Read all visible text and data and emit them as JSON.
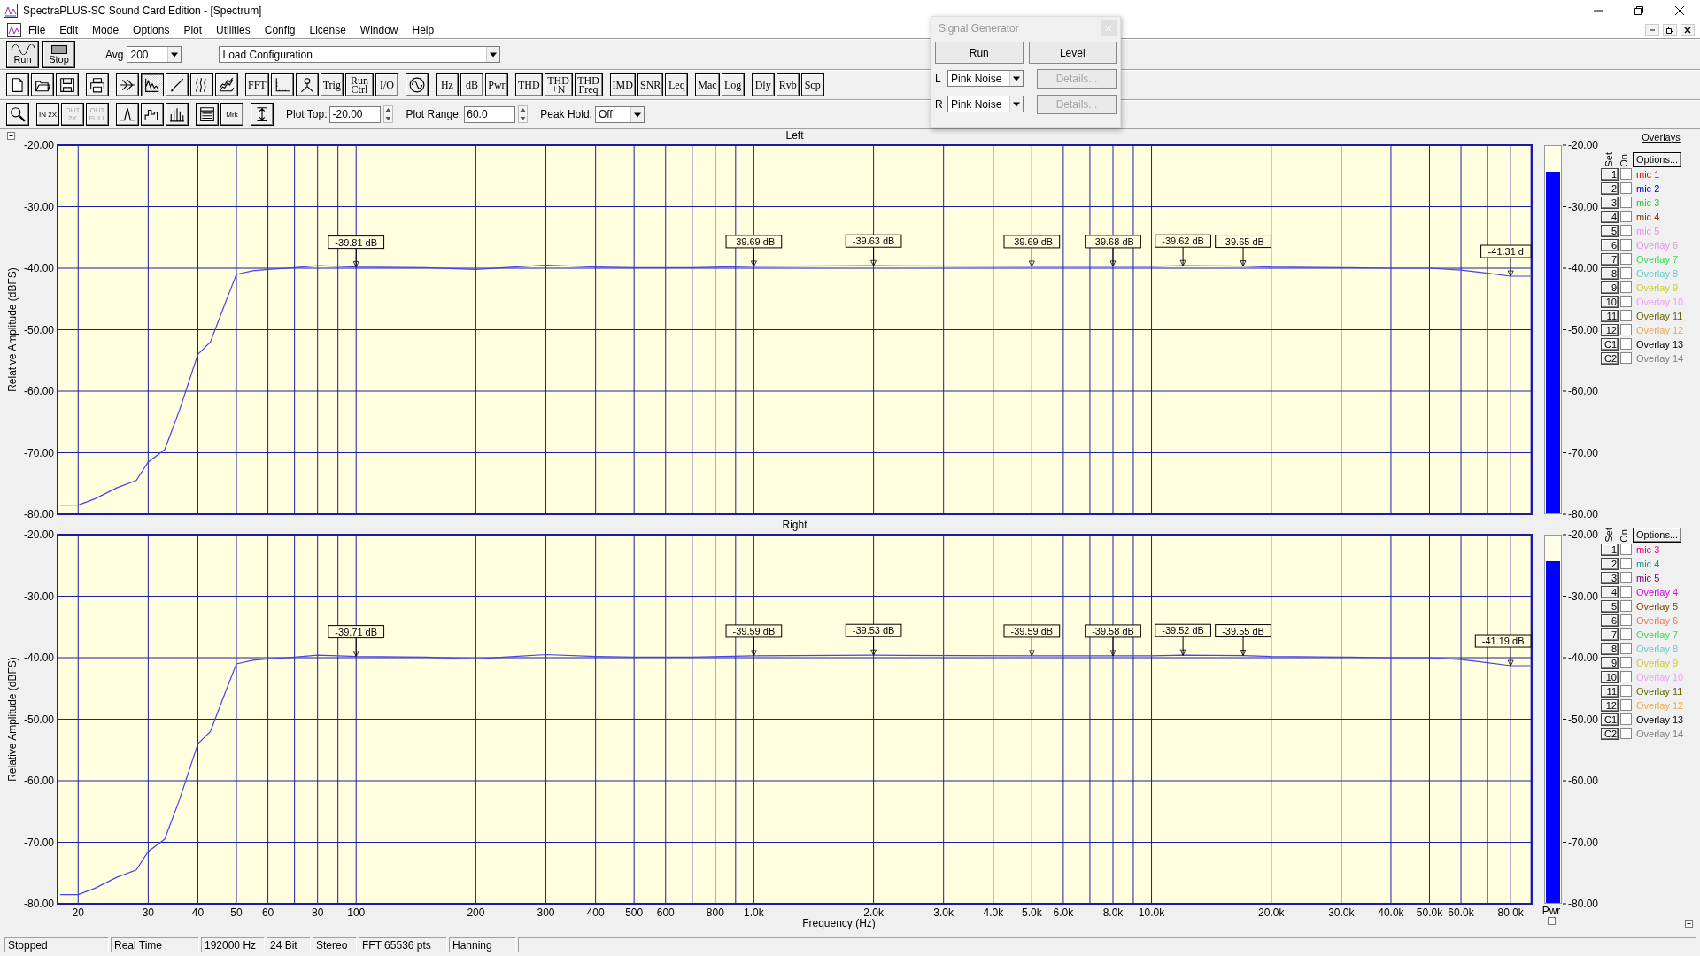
{
  "window": {
    "title": "SpectraPLUS-SC Sound Card Edition - [Spectrum]"
  },
  "menu": [
    "File",
    "Edit",
    "Mode",
    "Options",
    "Plot",
    "Utilities",
    "Config",
    "License",
    "Window",
    "Help"
  ],
  "toolbar1": {
    "run": "Run",
    "stop": "Stop",
    "avg_label": "Avg",
    "avg": "200",
    "config": "Load Configuration"
  },
  "toolbar2": [
    [
      {
        "kind": "icon"
      },
      {
        "kind": "icon"
      },
      {
        "kind": "icon"
      }
    ],
    [
      {
        "kind": "icon"
      }
    ],
    [
      {
        "kind": "icon",
        "selected": false
      },
      {
        "kind": "icon",
        "selected": true
      },
      {
        "kind": "icon",
        "selected": false
      },
      {
        "kind": "icon",
        "selected": false
      },
      {
        "kind": "icon",
        "selected": false
      }
    ],
    [
      {
        "kind": "text",
        "label": "FFT"
      },
      {
        "kind": "icon"
      },
      {
        "kind": "icon"
      },
      {
        "kind": "text",
        "label": "Trig"
      },
      {
        "kind": "text",
        "label": "Run Ctrl"
      },
      {
        "kind": "text",
        "label": "I/O"
      }
    ],
    [
      {
        "kind": "icon"
      }
    ],
    [
      {
        "kind": "text",
        "label": "Hz"
      },
      {
        "kind": "text",
        "label": "dB"
      },
      {
        "kind": "text",
        "label": "Pwr"
      }
    ],
    [
      {
        "kind": "text",
        "label": "THD"
      },
      {
        "kind": "text",
        "label": "THD +N"
      },
      {
        "kind": "text",
        "label": "THD Freq"
      }
    ],
    [
      {
        "kind": "text",
        "label": "IMD"
      },
      {
        "kind": "text",
        "label": "SNR"
      },
      {
        "kind": "text",
        "label": "Leq"
      }
    ],
    [
      {
        "kind": "text",
        "label": "Mac"
      },
      {
        "kind": "text",
        "label": "Log"
      }
    ],
    [
      {
        "kind": "text",
        "label": "Dly"
      },
      {
        "kind": "text",
        "label": "Rvb"
      },
      {
        "kind": "text",
        "label": "Scp"
      }
    ]
  ],
  "toolbar3": [
    [
      {
        "kind": "icon"
      }
    ],
    [
      {
        "kind": "text",
        "label": "IN 2X",
        "disabled": false
      },
      {
        "kind": "text",
        "label": "OUT 2X",
        "disabled": true
      },
      {
        "kind": "text",
        "label": "OUT FULL",
        "disabled": true
      }
    ],
    [
      {
        "kind": "icon"
      },
      {
        "kind": "icon"
      },
      {
        "kind": "icon"
      }
    ],
    [
      {
        "kind": "icon"
      },
      {
        "kind": "text",
        "label": "Mrk"
      }
    ],
    [
      {
        "kind": "icon"
      }
    ]
  ],
  "plot_controls": [
    {
      "kind": "spin",
      "label": "Plot Top:",
      "value": "-20.00"
    },
    {
      "kind": "spin",
      "label": "Plot Range:",
      "value": "60.0"
    },
    {
      "kind": "select",
      "label": "Peak Hold:",
      "value": "Off"
    }
  ],
  "signal_generator": {
    "title": "Signal Generator",
    "run": "Run",
    "level": "Level",
    "channels": [
      {
        "label": "L",
        "source": "Pink Noise",
        "details": "Details...",
        "disabled": true
      },
      {
        "label": "R",
        "source": "Pink Noise",
        "details": "Details...",
        "disabled": true
      }
    ]
  },
  "plots": [
    {
      "title": "Left",
      "ylabel": "Relative Amplitude (dBFS)",
      "yticks": [
        "-20.00",
        "-30.00",
        "-40.00",
        "-50.00",
        "-60.00",
        "-70.00",
        "-80.00"
      ],
      "markers": [
        "-39.81 dB",
        "-39.69 dB",
        "-39.63 dB",
        "-39.69 dB",
        "-39.68 dB",
        "-39.62 dB",
        "-39.65 dB",
        "-41.31 d"
      ]
    },
    {
      "title": "Right",
      "ylabel": "Relative Amplitude (dBFS)",
      "xlabel": "Frequency (Hz)",
      "yticks": [
        "-20.00",
        "-30.00",
        "-40.00",
        "-50.00",
        "-60.00",
        "-70.00",
        "-80.00"
      ],
      "xticks": [
        "20",
        "30",
        "40",
        "50",
        "60",
        "80",
        "100",
        "200",
        "300",
        "400",
        "500",
        "600",
        "800",
        "1.0k",
        "2.0k",
        "3.0k",
        "4.0k",
        "5.0k",
        "6.0k",
        "8.0k",
        "10.0k",
        "20.0k",
        "30.0k",
        "40.0k",
        "50.0k",
        "60.0k",
        "80.0k"
      ],
      "markers": [
        "-39.71 dB",
        "-39.59 dB",
        "-39.53 dB",
        "-39.59 dB",
        "-39.58 dB",
        "-39.52 dB",
        "-39.55 dB",
        "-41.19 dB"
      ]
    }
  ],
  "meters": [
    {
      "level": 0.93,
      "ticks": [
        "-20.00",
        "-30.00",
        "-40.00",
        "-50.00",
        "-60.00",
        "-70.00",
        "-80.00"
      ]
    },
    {
      "level": 0.93,
      "ticks": [
        "-20.00",
        "-30.00",
        "-40.00",
        "-50.00",
        "-60.00",
        "-70.00",
        "-80.00"
      ],
      "label": "Pwr"
    }
  ],
  "overlays": [
    {
      "title": "Overlays",
      "set_label": "Set",
      "on_label": "On",
      "options": "Options...",
      "items": [
        {
          "set": "1",
          "checked": false,
          "name": "mic 1",
          "color": "#e00000"
        },
        {
          "set": "2",
          "checked": false,
          "name": "mic 2",
          "color": "#0000c0"
        },
        {
          "set": "3",
          "checked": false,
          "name": "mic 3",
          "color": "#22cc22"
        },
        {
          "set": "4",
          "checked": false,
          "name": "mic 4",
          "color": "#804000"
        },
        {
          "set": "5",
          "checked": false,
          "name": "mic 5",
          "color": "#e890e8"
        },
        {
          "set": "6",
          "checked": false,
          "name": "Overlay 6",
          "color": "#e890e8"
        },
        {
          "set": "7",
          "checked": false,
          "name": "Overlay 7",
          "color": "#33dd55"
        },
        {
          "set": "8",
          "checked": false,
          "name": "Overlay 8",
          "color": "#66cccc"
        },
        {
          "set": "9",
          "checked": false,
          "name": "Overlay 9",
          "color": "#cccc33"
        },
        {
          "set": "10",
          "checked": false,
          "name": "Overlay 10",
          "color": "#f0a0f0"
        },
        {
          "set": "11",
          "checked": false,
          "name": "Overlay 11",
          "color": "#666600"
        },
        {
          "set": "12",
          "checked": false,
          "name": "Overlay 12",
          "color": "#f0a850"
        },
        {
          "set": "C1",
          "checked": false,
          "name": "Overlay 13",
          "color": "#000000"
        },
        {
          "set": "C2",
          "checked": false,
          "name": "Overlay 14",
          "color": "#808080"
        }
      ]
    },
    {
      "set_label": "Set",
      "on_label": "On",
      "options": "Options...",
      "items": [
        {
          "set": "1",
          "checked": false,
          "name": "mic 3",
          "color": "#e0007f"
        },
        {
          "set": "2",
          "checked": false,
          "name": "mic 4",
          "color": "#119999"
        },
        {
          "set": "3",
          "checked": false,
          "name": "mic 5",
          "color": "#800080"
        },
        {
          "set": "4",
          "checked": false,
          "name": "Overlay 4",
          "color": "#e000e0"
        },
        {
          "set": "5",
          "checked": false,
          "name": "Overlay 5",
          "color": "#804000"
        },
        {
          "set": "6",
          "checked": false,
          "name": "Overlay 6",
          "color": "#f07050"
        },
        {
          "set": "7",
          "checked": false,
          "name": "Overlay 7",
          "color": "#33dd55"
        },
        {
          "set": "8",
          "checked": false,
          "name": "Overlay 8",
          "color": "#66cccc"
        },
        {
          "set": "9",
          "checked": false,
          "name": "Overlay 9",
          "color": "#cccc33"
        },
        {
          "set": "10",
          "checked": false,
          "name": "Overlay 10",
          "color": "#f0a0f0"
        },
        {
          "set": "11",
          "checked": false,
          "name": "Overlay 11",
          "color": "#666600"
        },
        {
          "set": "12",
          "checked": false,
          "name": "Overlay 12",
          "color": "#f0a850"
        },
        {
          "set": "C1",
          "checked": false,
          "name": "Overlay 13",
          "color": "#000000"
        },
        {
          "set": "C2",
          "checked": false,
          "name": "Overlay 14",
          "color": "#808080"
        }
      ]
    }
  ],
  "status_bar": [
    "Stopped",
    "Real Time",
    "192000 Hz",
    "24 Bit",
    "Stereo",
    "FFT 65536 pts",
    "Hanning"
  ]
}
